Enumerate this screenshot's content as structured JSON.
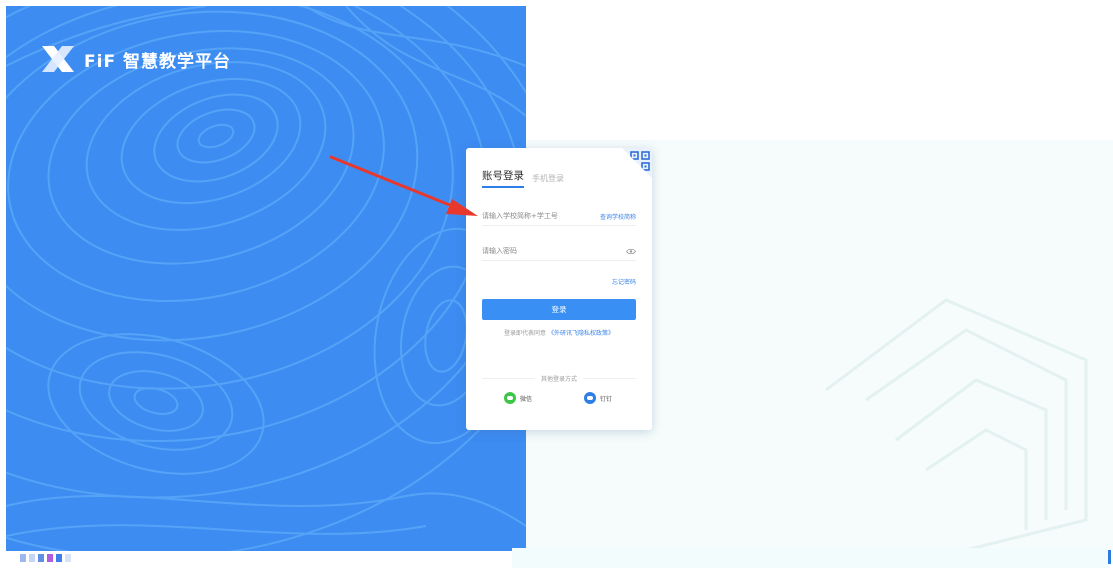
{
  "brand": {
    "name": "FiF 智慧教学平台",
    "panel_color": "#3d8cf2"
  },
  "login": {
    "tab_account": "账号登录",
    "tab_phone": "手机登录",
    "account_placeholder": "请输入学校简称+学工号",
    "lookup_link": "查询学校简称",
    "password_placeholder": "请输入密码",
    "forgot_link": "忘记密码",
    "login_button": "登录",
    "agreement_prefix": "登录即代表同意",
    "agreement_link": "《外研讯飞隐私权政策》",
    "other_methods": "其他登录方式",
    "wechat_label": "微信",
    "dingtalk_label": "钉钉",
    "accent_color": "#3a8ff5",
    "wechat_color": "#3ec54a",
    "dingtalk_color": "#2f7ee6"
  },
  "annotation": {
    "arrow_color": "#e8382e"
  },
  "icons": {
    "logo": "fif-x-logo-icon",
    "qr": "qr-code-icon",
    "eye": "eye-icon",
    "wechat": "wechat-icon",
    "dingtalk": "dingtalk-icon"
  }
}
